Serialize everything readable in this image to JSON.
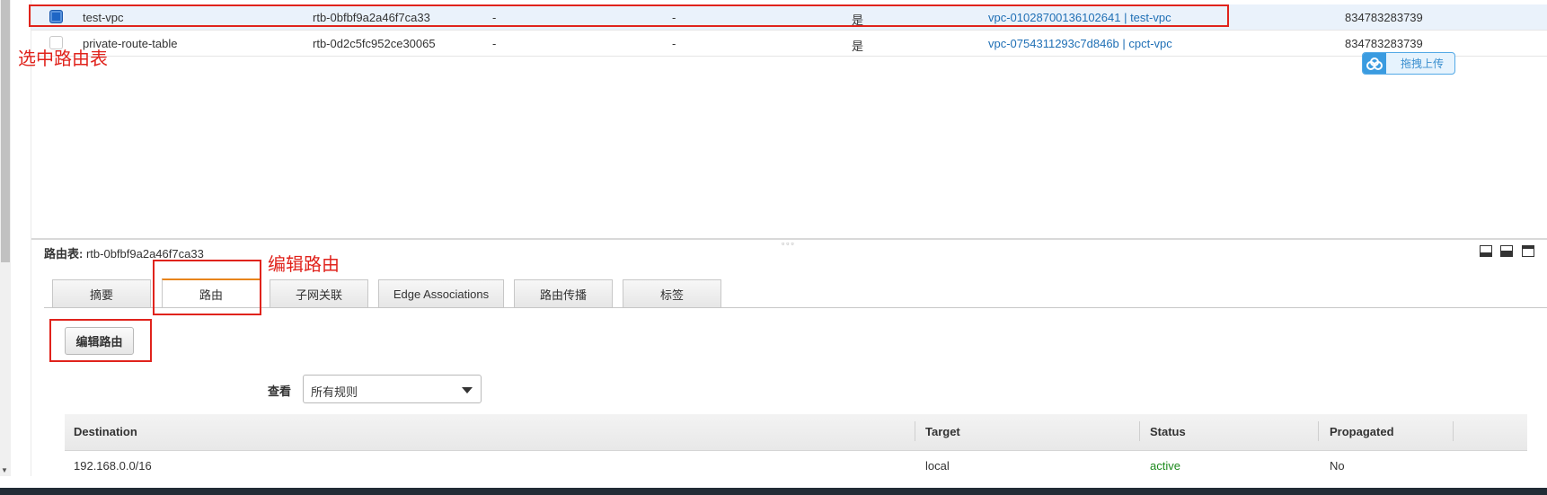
{
  "route_tables": {
    "rows": [
      {
        "name": "test-vpc",
        "id": "rtb-0bfbf9a2a46f7ca33",
        "col3": "-",
        "col4": "-",
        "main": "是",
        "vpc": "vpc-01028700136102641 | test-vpc",
        "owner": "834783283739",
        "selected": true
      },
      {
        "name": "private-route-table",
        "id": "rtb-0d2c5fc952ce30065",
        "col3": "-",
        "col4": "-",
        "main": "是",
        "vpc": "vpc-0754311293c7d846b | cpct-vpc",
        "owner": "834783283739",
        "selected": false
      }
    ]
  },
  "annotations": {
    "select_route_table": "选中路由表",
    "edit_route": "编辑路由"
  },
  "upload_widget": {
    "label": "拖拽上传",
    "icon": "cloud-icon"
  },
  "details": {
    "title_label": "路由表:",
    "title_value": "rtb-0bfbf9a2a46f7ca33",
    "window_buttons": [
      "minimize-icon",
      "half-icon",
      "maximize-icon"
    ]
  },
  "tabs": [
    {
      "label": "摘要",
      "active": false
    },
    {
      "label": "路由",
      "active": true
    },
    {
      "label": "子网关联",
      "active": false
    },
    {
      "label": "Edge Associations",
      "active": false
    },
    {
      "label": "路由传播",
      "active": false
    },
    {
      "label": "标签",
      "active": false
    }
  ],
  "routes": {
    "edit_button": "编辑路由",
    "view_label": "查看",
    "filter_value": "所有规则",
    "columns": [
      "Destination",
      "Target",
      "Status",
      "Propagated"
    ],
    "rows": [
      {
        "destination": "192.168.0.0/16",
        "target": "local",
        "status": "active",
        "propagated": "No"
      }
    ]
  },
  "colors": {
    "accent": "#e8841a",
    "link": "#1f6fb5",
    "annotation": "#e0231c",
    "status_active": "#1d8a1d"
  }
}
